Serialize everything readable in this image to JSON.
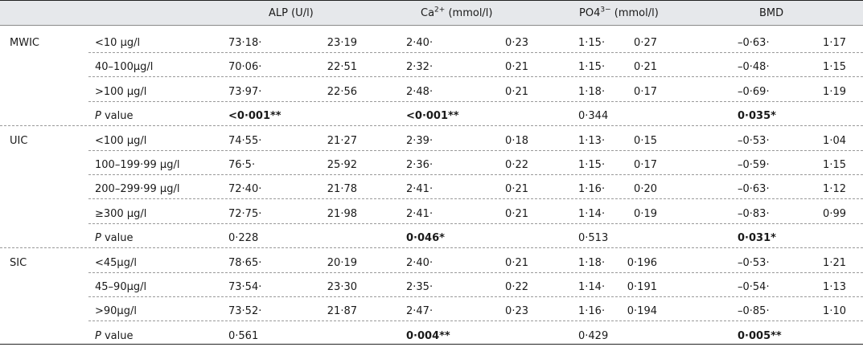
{
  "header": {
    "alp": "ALP (U/l)",
    "ca_base": "Ca",
    "ca_sup": "2+",
    "ca_unit": " (mmol/l)",
    "po_base": "PO4",
    "po_sup": "3−",
    "po_unit": " (mmol/l)",
    "bmd": "BMD"
  },
  "groups": [
    {
      "label": "MWIC",
      "rows": [
        {
          "cat": "<10 µg/l",
          "alp_m": "73·18·",
          "alp_sd": "23·19",
          "ca_m": "2·40·",
          "ca_sd": "0·23",
          "po_m": "1·15·",
          "po_sd": "0·27",
          "bmd_m": "–0·63·",
          "bmd_sd": "1·17"
        },
        {
          "cat": "40–100µg/l",
          "alp_m": "70·06·",
          "alp_sd": "22·51",
          "ca_m": "2·32·",
          "ca_sd": "0·21",
          "po_m": "1·15·",
          "po_sd": "0·21",
          "bmd_m": "–0·48·",
          "bmd_sd": "1·15"
        },
        {
          "cat": ">100 µg/l",
          "alp_m": "73·97·",
          "alp_sd": "22·56",
          "ca_m": "2·48·",
          "ca_sd": "0·21",
          "po_m": "1·18·",
          "po_sd": "0·17",
          "bmd_m": "–0·69·",
          "bmd_sd": "1·19"
        }
      ],
      "p": {
        "label_italic": "P",
        "label_rest": " value",
        "alp": "<0·001**",
        "alp_bold": true,
        "ca": "<0·001**",
        "ca_bold": true,
        "po": "0·344",
        "po_bold": false,
        "bmd": "0·035*",
        "bmd_bold": true
      }
    },
    {
      "label": "UIC",
      "rows": [
        {
          "cat": "<100 µg/l",
          "alp_m": "74·55·",
          "alp_sd": "21·27",
          "ca_m": "2·39·",
          "ca_sd": "0·18",
          "po_m": "1·13·",
          "po_sd": "0·15",
          "bmd_m": "–0·53·",
          "bmd_sd": "1·04"
        },
        {
          "cat": "100–199·99 µg/l",
          "alp_m": "76·5·",
          "alp_sd": "25·92",
          "ca_m": "2·36·",
          "ca_sd": "0·22",
          "po_m": "1·15·",
          "po_sd": "0·17",
          "bmd_m": "–0·59·",
          "bmd_sd": "1·15"
        },
        {
          "cat": "200–299·99 µg/l",
          "alp_m": "72·40·",
          "alp_sd": "21·78",
          "ca_m": "2·41·",
          "ca_sd": "0·21",
          "po_m": "1·16·",
          "po_sd": "0·20",
          "bmd_m": "–0·63·",
          "bmd_sd": "1·12"
        },
        {
          "cat": "≥300 µg/l",
          "alp_m": "72·75·",
          "alp_sd": "21·98",
          "ca_m": "2·41·",
          "ca_sd": "0·21",
          "po_m": "1·14·",
          "po_sd": "0·19",
          "bmd_m": "–0·83·",
          "bmd_sd": "0·99"
        }
      ],
      "p": {
        "label_italic": "P",
        "label_rest": " value",
        "alp": "0·228",
        "alp_bold": false,
        "ca": "0·046*",
        "ca_bold": true,
        "po": "0·513",
        "po_bold": false,
        "bmd": "0·031*",
        "bmd_bold": true
      }
    },
    {
      "label": "SIC",
      "rows": [
        {
          "cat": "<45µg/l",
          "alp_m": "78·65·",
          "alp_sd": "20·19",
          "ca_m": "2·40·",
          "ca_sd": "0·21",
          "po_m": "1·18·",
          "po_sd": "0·196",
          "bmd_m": "–0·53·",
          "bmd_sd": "1·21"
        },
        {
          "cat": "45–90µg/l",
          "alp_m": "73·54·",
          "alp_sd": "23·30",
          "ca_m": "2·35·",
          "ca_sd": "0·22",
          "po_m": "1·14·",
          "po_sd": "0·191",
          "bmd_m": "–0·54·",
          "bmd_sd": "1·13"
        },
        {
          "cat": ">90µg/l",
          "alp_m": "73·52·",
          "alp_sd": "21·87",
          "ca_m": "2·47·",
          "ca_sd": "0·23",
          "po_m": "1·16·",
          "po_sd": "0·194",
          "bmd_m": "–0·85·",
          "bmd_sd": "1·10"
        }
      ],
      "p": {
        "label_italic": "P",
        "label_rest": " value",
        "alp": "0·561",
        "alp_bold": false,
        "ca": "0·004**",
        "ca_bold": true,
        "po": "0·429",
        "po_bold": false,
        "bmd": "0·005**",
        "bmd_bold": true
      }
    }
  ]
}
